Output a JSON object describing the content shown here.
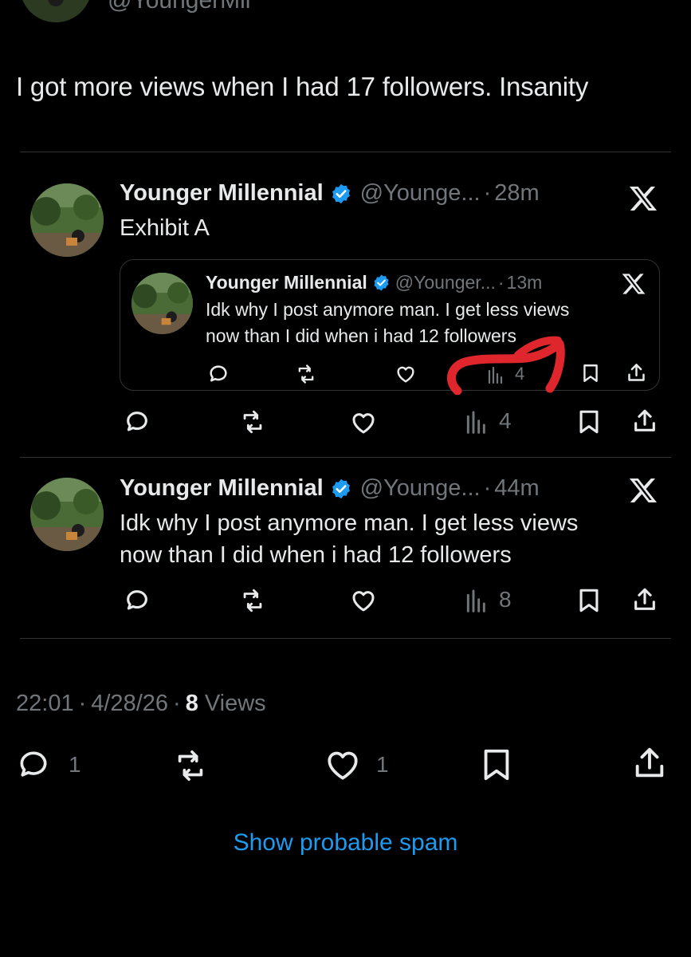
{
  "top_handle": "@YoungerMil",
  "main_tweet_text": "I got more views when I had 17 followers. Insanity",
  "tweet1": {
    "name": "Younger Millennial",
    "handle": "@Younge...",
    "time": "28m",
    "text": "Exhibit A",
    "views": "4",
    "quote": {
      "name": "Younger Millennial",
      "handle": "@Younger...",
      "time": "13m",
      "text_line1": "Idk why I post anymore man. I get less views",
      "text_line2": "now than I did when i had 12 followers",
      "views": "4"
    }
  },
  "tweet2": {
    "name": "Younger Millennial",
    "handle": "@Younge...",
    "time": "44m",
    "text_line1": "Idk why I post anymore man. I get less views",
    "text_line2": "now than I did when i had 12 followers",
    "views": "8"
  },
  "meta": {
    "time": "22:01",
    "date": "4/28/26",
    "views_count": "8",
    "views_label": "Views",
    "dot": "·"
  },
  "actions": {
    "replies": "1",
    "likes": "1"
  },
  "show_spam": "Show probable spam",
  "colors": {
    "background": "#000000",
    "text": "#e7e9ea",
    "muted": "#71767b",
    "link": "#1d9bf0",
    "verified": "#1d9bf0",
    "scribble": "#e0262d"
  }
}
